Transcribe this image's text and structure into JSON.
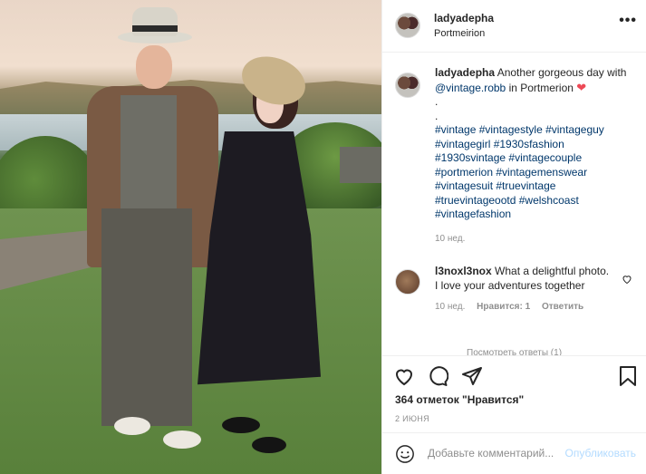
{
  "header": {
    "username": "ladyadepha",
    "location": "Portmeirion",
    "more": "•••"
  },
  "caption": {
    "username": "ladyadepha",
    "text_before": "Another gorgeous day with",
    "mention": "@vintage.robb",
    "text_after": "in Portmerion",
    "heart": "❤",
    "dot1": ".",
    "dot2": ".",
    "hashtags": "#vintage #vintagestyle #vintageguy #vintagegirl #1930sfashion #1930svintage #vintagecouple #portmerion #vintagemenswear #vintagesuit #truevintage #truevintageootd #welshcoast #vintagefashion",
    "time": "10 нед."
  },
  "comment": {
    "username": "l3noxl3nox",
    "text": "What a delightful photo. I love your adventures together",
    "time": "10 нед.",
    "likes": "Нравится: 1",
    "reply": "Ответить",
    "show_replies": "Посмотреть ответы (1)"
  },
  "actions": {
    "likes": "364 отметок \"Нравится\"",
    "date": "2 ИЮНЯ"
  },
  "add_comment": {
    "placeholder": "Добавьте комментарий...",
    "post": "Опубликовать"
  },
  "colors": {
    "link": "#00376b",
    "heart": "#ed4956",
    "muted": "#8e8e8e",
    "post": "#b3dbff"
  }
}
